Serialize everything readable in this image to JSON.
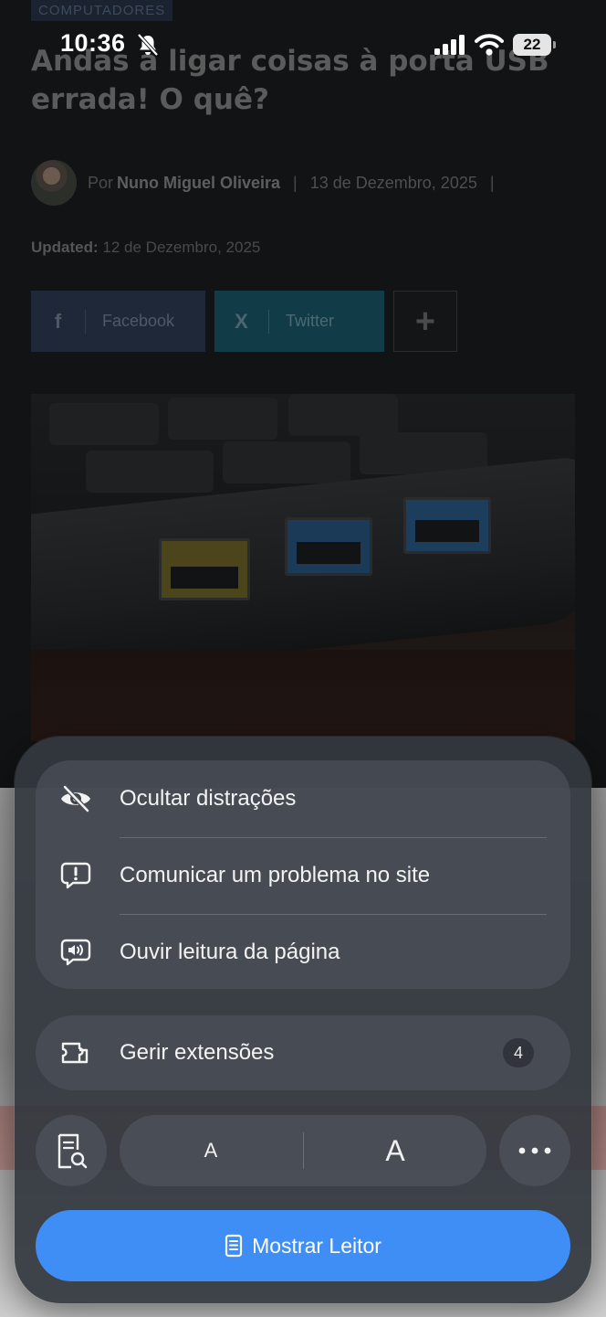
{
  "status_bar": {
    "time": "10:36",
    "battery": "22"
  },
  "article": {
    "category": "COMPUTADORES",
    "headline": "Andas a ligar coisas à porta USB errada! O quê?",
    "author_prefix": "Por",
    "author": "Nuno Miguel Oliveira",
    "separator": "|",
    "date": "13 de Dezembro, 2025",
    "updated_label": "Updated:",
    "updated_date": "12 de Dezembro, 2025",
    "share": {
      "facebook_icon": "f",
      "facebook": "Facebook",
      "twitter_icon": "X",
      "twitter": "Twitter",
      "more": "+"
    }
  },
  "menu": {
    "items": [
      {
        "label": "Ocultar distrações",
        "icon": "eye-slash-icon"
      },
      {
        "label": "Comunicar um problema no site",
        "icon": "report-bubble-icon"
      },
      {
        "label": "Ouvir leitura da página",
        "icon": "speaker-bubble-icon"
      }
    ],
    "extensions": {
      "label": "Gerir extensões",
      "count": "4",
      "icon": "puzzle-icon"
    },
    "font_small": "A",
    "font_large": "A",
    "reader_button": "Mostrar Leitor"
  },
  "colors": {
    "accent": "#3e8ef5",
    "sheet": "#343840"
  }
}
